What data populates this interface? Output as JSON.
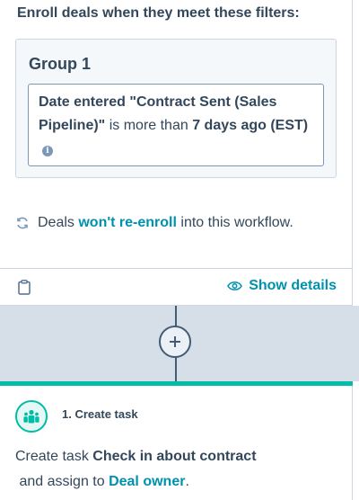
{
  "trigger": {
    "heading": "Enroll deals when they meet these filters:",
    "group_title": "Group 1",
    "filter": {
      "part1": "Date entered \"Contract Sent (Sales Pipeline)\"",
      "part2": " is more than ",
      "part3": "7 days ago (EST)"
    },
    "reenroll": {
      "prefix": "Deals ",
      "link": "won't re-enroll",
      "suffix": " into this workflow."
    },
    "show_details_label": "Show details"
  },
  "connector": {
    "add_label": "+"
  },
  "action": {
    "title": "1. Create task",
    "desc": {
      "part1": "Create task ",
      "task_name": "Check in about contract",
      "part2": " and assign to ",
      "owner": "Deal owner",
      "part3": "."
    }
  },
  "colors": {
    "accent_link": "#0091ae",
    "action_accent": "#00bda5",
    "text": "#33475b",
    "connector_bg": "#d6dfe8"
  }
}
